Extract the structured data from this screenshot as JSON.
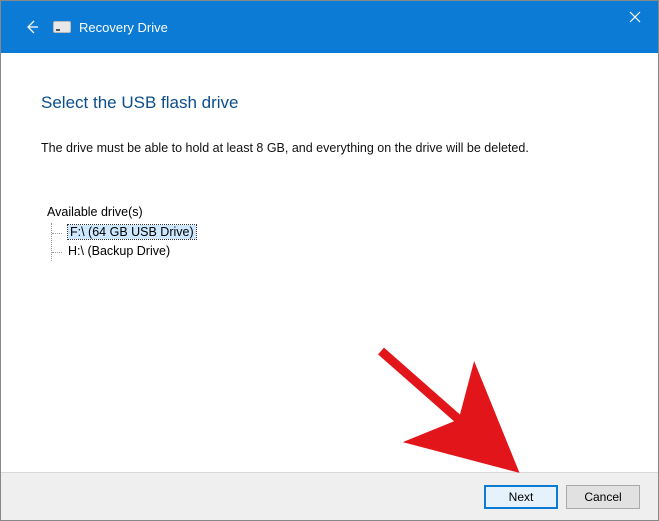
{
  "window": {
    "title": "Recovery Drive"
  },
  "page": {
    "heading": "Select the USB flash drive",
    "instruction": "The drive must be able to hold at least 8 GB, and everything on the drive will be deleted.",
    "available_label": "Available drive(s)"
  },
  "drives": [
    {
      "label": "F:\\ (64 GB USB Drive)",
      "selected": true
    },
    {
      "label": "H:\\ (Backup Drive)",
      "selected": false
    }
  ],
  "buttons": {
    "next": "Next",
    "cancel": "Cancel"
  },
  "colors": {
    "titlebar": "#0b7bd6",
    "heading": "#0b4e8c",
    "selection": "#cde8ff",
    "annotation_arrow": "#e2161a"
  }
}
